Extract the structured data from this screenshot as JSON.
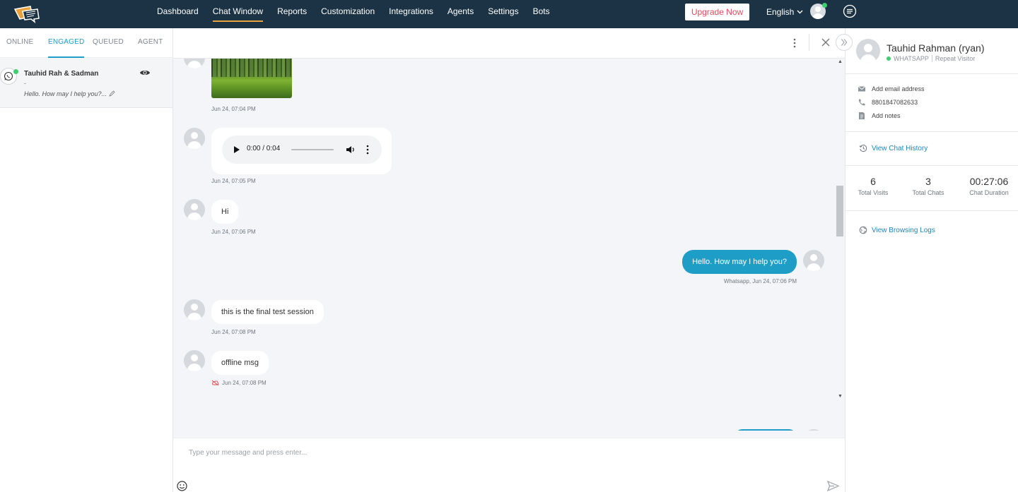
{
  "topbar": {
    "nav": [
      "Dashboard",
      "Chat Window",
      "Reports",
      "Customization",
      "Integrations",
      "Agents",
      "Settings",
      "Bots"
    ],
    "active_nav": "Chat Window",
    "upgrade_label": "Upgrade Now",
    "language": "English",
    "accent_color": "#e8a33d",
    "bar_color": "#1b3344"
  },
  "left_panel": {
    "tabs": [
      "ONLINE",
      "ENGAGED",
      "QUEUED",
      "AGENT"
    ],
    "active_tab": "ENGAGED",
    "chat": {
      "name": "Tauhid Rah & Sadman",
      "dash": "-",
      "preview": "Hello. How may I help you?...",
      "channel_icon": "whatsapp-icon"
    }
  },
  "messages": {
    "image_ts": "Jun 24, 07:04 PM",
    "audio": {
      "time": "0:00 / 0:04",
      "ts": "Jun 24, 07:05 PM"
    },
    "hi": {
      "text": "Hi",
      "ts": "Jun 24, 07:06 PM"
    },
    "agent_reply": {
      "text": "Hello. How may I help you?",
      "ts": "Whatsapp, Jun 24, 07:06 PM"
    },
    "final_test": {
      "text": "this is the final test session",
      "ts": "Jun 24, 07:08 PM"
    },
    "offline": {
      "text": "offline msg",
      "ts": "Jun 24, 07:08 PM"
    }
  },
  "composer": {
    "placeholder": "Type your message and press enter..."
  },
  "right_panel": {
    "name": "Tauhid Rahman (ryan)",
    "channel": "WHATSAPP",
    "visitor_type": "Repeat Visitor",
    "email": "Add email address",
    "phone": "8801847082633",
    "notes": "Add notes",
    "history_link": "View Chat History",
    "stats": [
      {
        "value": "6",
        "label": "Total Visits"
      },
      {
        "value": "3",
        "label": "Total Chats"
      },
      {
        "value": "00:27:06",
        "label": "Chat Duration"
      }
    ],
    "logs_link": "View Browsing Logs",
    "link_color": "#1e86b8"
  }
}
